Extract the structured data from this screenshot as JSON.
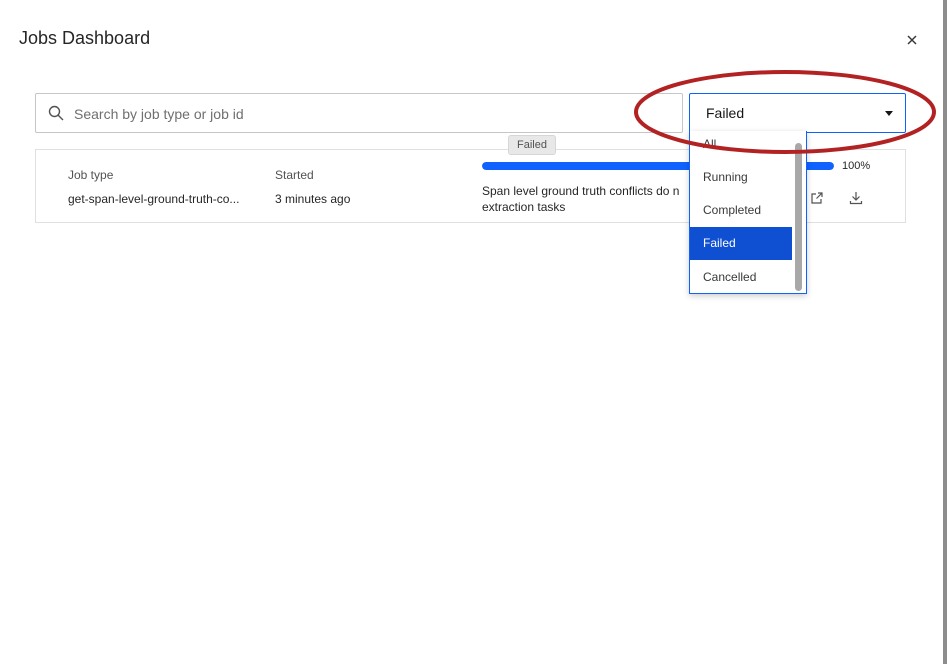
{
  "modal": {
    "title": "Jobs Dashboard"
  },
  "search": {
    "placeholder": "Search by job type or job id",
    "value": ""
  },
  "filter": {
    "selected": "Failed",
    "options": [
      "All",
      "Running",
      "Completed",
      "Failed",
      "Cancelled"
    ]
  },
  "job": {
    "type_label": "Job type",
    "type_value": "get-span-level-ground-truth-co...",
    "started_label": "Started",
    "started_value": "3 minutes ago",
    "progress": 100,
    "progress_text": "100%",
    "message": "Span level ground truth conflicts do n extraction tasks",
    "status_tooltip": "Failed"
  },
  "colors": {
    "accent": "#0f62fe",
    "selected_bg": "#0f4fd1",
    "annotation": "#b22222"
  }
}
